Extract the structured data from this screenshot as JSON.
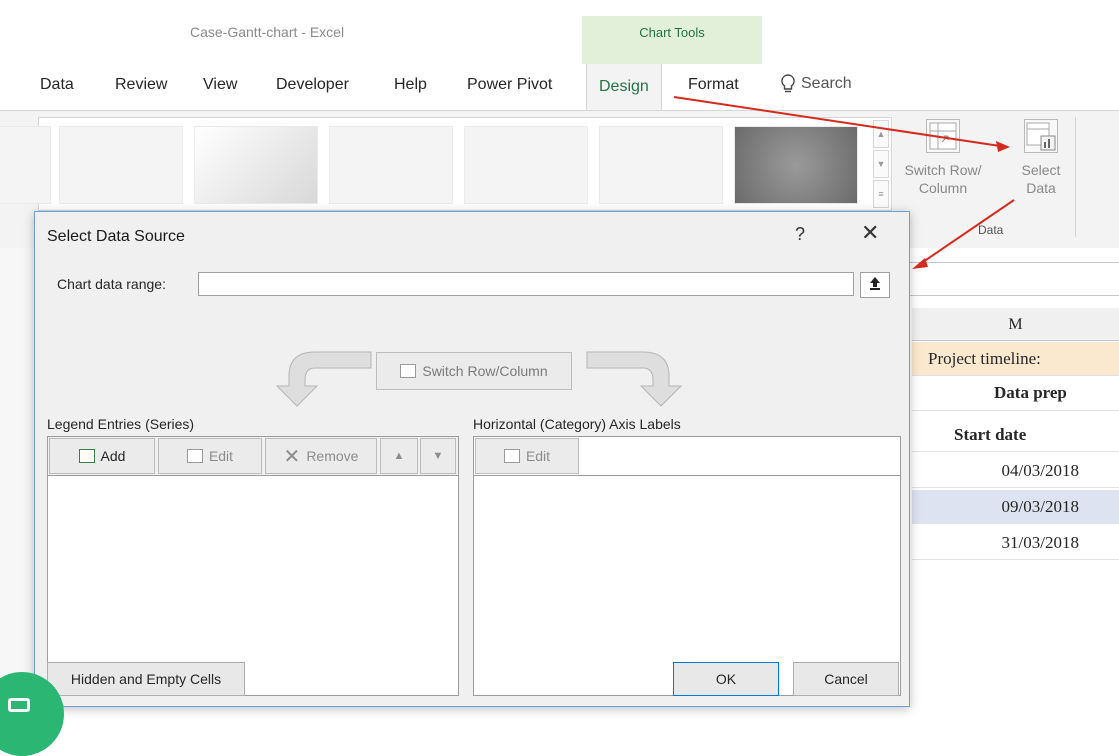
{
  "app": {
    "document_title": "Case-Gantt-chart  -  Excel",
    "context_group_label": "Chart Tools"
  },
  "tabs": [
    {
      "label": "Data"
    },
    {
      "label": "Review"
    },
    {
      "label": "View"
    },
    {
      "label": "Developer"
    },
    {
      "label": "Help"
    },
    {
      "label": "Power Pivot"
    },
    {
      "label": "Design",
      "active": true
    },
    {
      "label": "Format"
    }
  ],
  "search": {
    "label": "Search",
    "icon": "lightbulb-icon"
  },
  "ribbon": {
    "switch_row_column": {
      "line1": "Switch Row/",
      "line2": "Column"
    },
    "select_data": {
      "line1": "Select",
      "line2": "Data"
    },
    "data_group_label": "Data"
  },
  "sheet": {
    "column_header": "M",
    "project_timeline": "Project timeline:",
    "data_prep": "Data prep",
    "start_date": "Start date",
    "dates": [
      "04/03/2018",
      "09/03/2018",
      "31/03/2018"
    ]
  },
  "dialog": {
    "title": "Select Data Source",
    "help": "?",
    "close": "✕",
    "chart_range_label": "Chart data range:",
    "chart_range_value": "",
    "collapse_icon": "⇪",
    "switch_row_column": "Switch Row/Column",
    "legend_label": "Legend Entries (Series)",
    "axis_label": "Horizontal (Category) Axis Labels",
    "legend_buttons": {
      "add": "Add",
      "edit": "Edit",
      "remove": "Remove"
    },
    "axis_buttons": {
      "edit": "Edit"
    },
    "hidden_empty": "Hidden and Empty Cells",
    "ok": "OK",
    "cancel": "Cancel"
  },
  "colors": {
    "excel_green": "#217346",
    "context_tab_bg": "#e2f0d9",
    "annotation_red": "#d52b1e",
    "brand_circle": "#2bb673"
  }
}
